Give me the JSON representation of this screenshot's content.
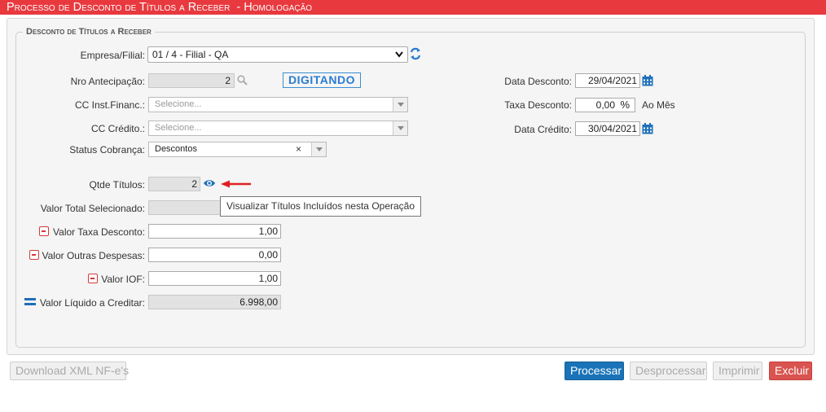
{
  "title": "Processo de Desconto de Títulos a Receber  - Homologação",
  "section": {
    "legend": "Desconto de Títulos a Receber"
  },
  "form": {
    "empresa_label": "Empresa/Filial:",
    "empresa_value": "01 / 4 - Filial - QA",
    "nro_antecipacao_label": "Nro Antecipação:",
    "nro_antecipacao_value": "2",
    "status_badge": "DIGITANDO",
    "cc_inst_label": "CC Inst.Financ.:",
    "cc_inst_placeholder": "Selecione...",
    "cc_credito_label": "CC Crédito.:",
    "cc_credito_placeholder": "Selecione...",
    "status_cobranca_label": "Status Cobrança:",
    "status_cobranca_value": "Descontos",
    "data_desconto_label": "Data Desconto:",
    "data_desconto_value": "29/04/2021",
    "taxa_desconto_label": "Taxa Desconto:",
    "taxa_desconto_value": "0,00",
    "taxa_unit": "%",
    "ao_mes": "Ao Mês",
    "data_credito_label": "Data Crédito:",
    "data_credito_value": "30/04/2021",
    "qtde_titulos_label": "Qtde Títulos:",
    "qtde_titulos_value": "2",
    "tooltip": "Visualizar Títulos Incluídos nesta Operação",
    "valor_total_label": "Valor Total Selecionado:",
    "valor_taxa_label": "Valor Taxa Desconto:",
    "valor_taxa_value": "1,00",
    "valor_outras_label": "Valor Outras Despesas:",
    "valor_outras_value": "0,00",
    "valor_iof_label": "Valor IOF:",
    "valor_iof_value": "1,00",
    "valor_liquido_label": "Valor Líquido a Creditar:",
    "valor_liquido_value": "6.998,00"
  },
  "buttons": {
    "download": "Download XML NF-e's",
    "processar": "Processar",
    "desprocessar": "Desprocessar",
    "imprimir": "Imprimir",
    "excluir": "Excluir"
  },
  "colors": {
    "titlebar": "#e8393f",
    "primary": "#1a73b8",
    "danger": "#d9534f",
    "minus_icon": "#d43a3a",
    "arrow": "#e02020"
  },
  "icons": [
    "refresh-icon",
    "search-icon",
    "calendar-icon",
    "eye-icon",
    "arrow-left-icon",
    "minus-icon",
    "equals-icon",
    "chevron-down-icon",
    "clear-icon"
  ]
}
